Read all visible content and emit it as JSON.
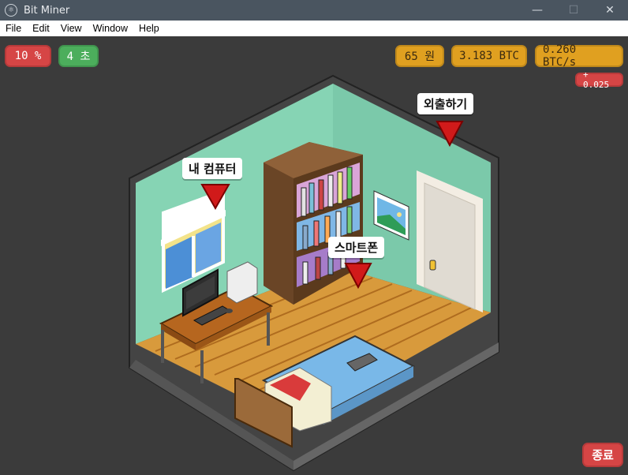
{
  "window": {
    "title": "Bit Miner"
  },
  "menu": {
    "items": [
      "File",
      "Edit",
      "View",
      "Window",
      "Help"
    ]
  },
  "hud": {
    "progress": "10 %",
    "timer": "4 초",
    "money": "65 원",
    "btc": "3.183 BTC",
    "rate": "0.260 BTC/s",
    "delta": "+ 0.025"
  },
  "scene": {
    "labels": {
      "computer": "내 컴퓨터",
      "phone": "스마트폰",
      "door": "외출하기"
    }
  },
  "buttons": {
    "end": "종료"
  },
  "colors": {
    "red": "#d64545",
    "green": "#4cae5c",
    "gold": "#e0a020",
    "marker": "#d11a1a"
  }
}
